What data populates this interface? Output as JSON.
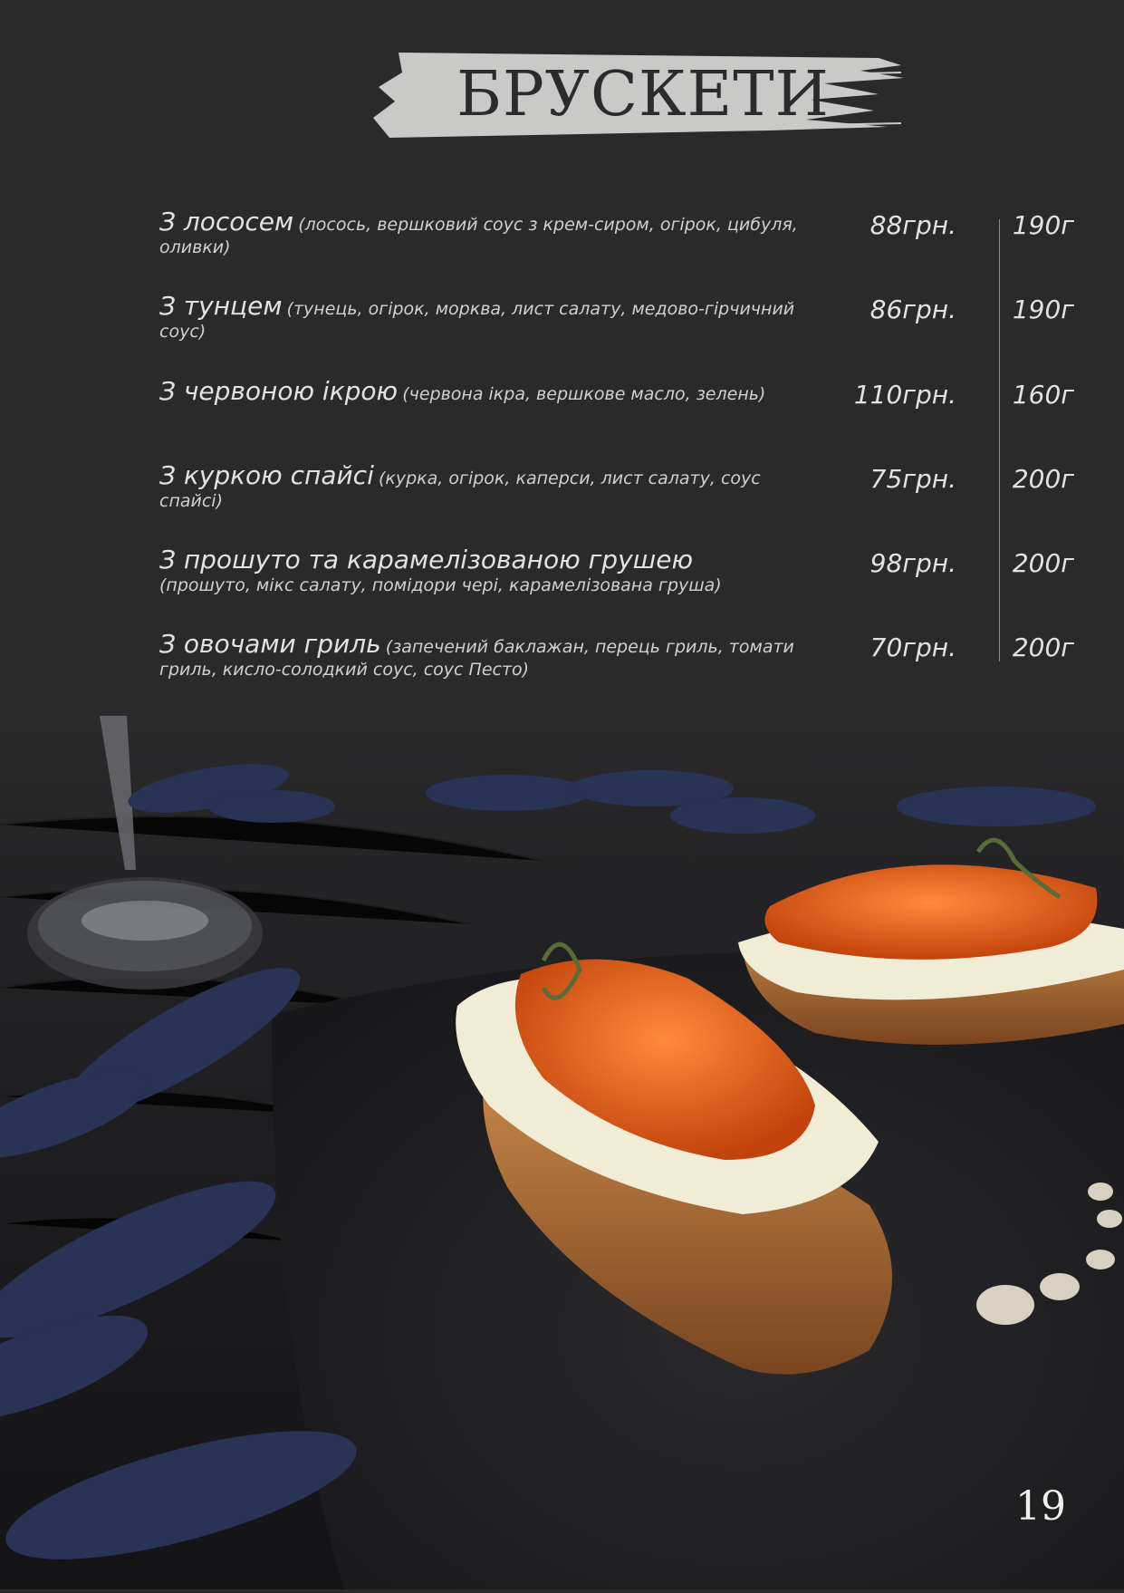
{
  "page": {
    "title": "БРУСКЕТИ",
    "number": "19"
  },
  "menu": {
    "items": [
      {
        "name": "З лососем",
        "ingredients": "(лосось, вершковий соус з крем-сиром, огірок, цибуля, оливки)",
        "price": "88грн.",
        "weight": "190г"
      },
      {
        "name": "З тунцем",
        "ingredients": "(тунець, огірок, морква, лист салату, медово-гірчичний соус)",
        "price": "86грн.",
        "weight": "190г"
      },
      {
        "name": "З червоною ікрою",
        "ingredients": "(червона ікра, вершкове масло, зелень)",
        "price": "110грн.",
        "weight": "160г"
      },
      {
        "name": "З куркою спайсі",
        "ingredients": "(курка, огірок, каперси, лист салату, соус спайсі)",
        "price": "75грн.",
        "weight": "200г"
      },
      {
        "name": "З прошуто та карамелізованою грушею",
        "ingredients": "(прошуто, мікс салату, помідори чері, карамелізована груша)",
        "price": "98грн.",
        "weight": "200г"
      },
      {
        "name": "З овочами гриль",
        "ingredients": "(запечений баклажан, перець гриль, томати гриль, кисло-солодкий соус, соус Песто)",
        "price": "70грн.",
        "weight": "200г"
      }
    ]
  },
  "colors": {
    "background": "#2a2a2b",
    "title_brush": "#c9c9c7",
    "caviar": "#e0601a"
  },
  "photo": {
    "icon": "bruschetta-photo"
  }
}
